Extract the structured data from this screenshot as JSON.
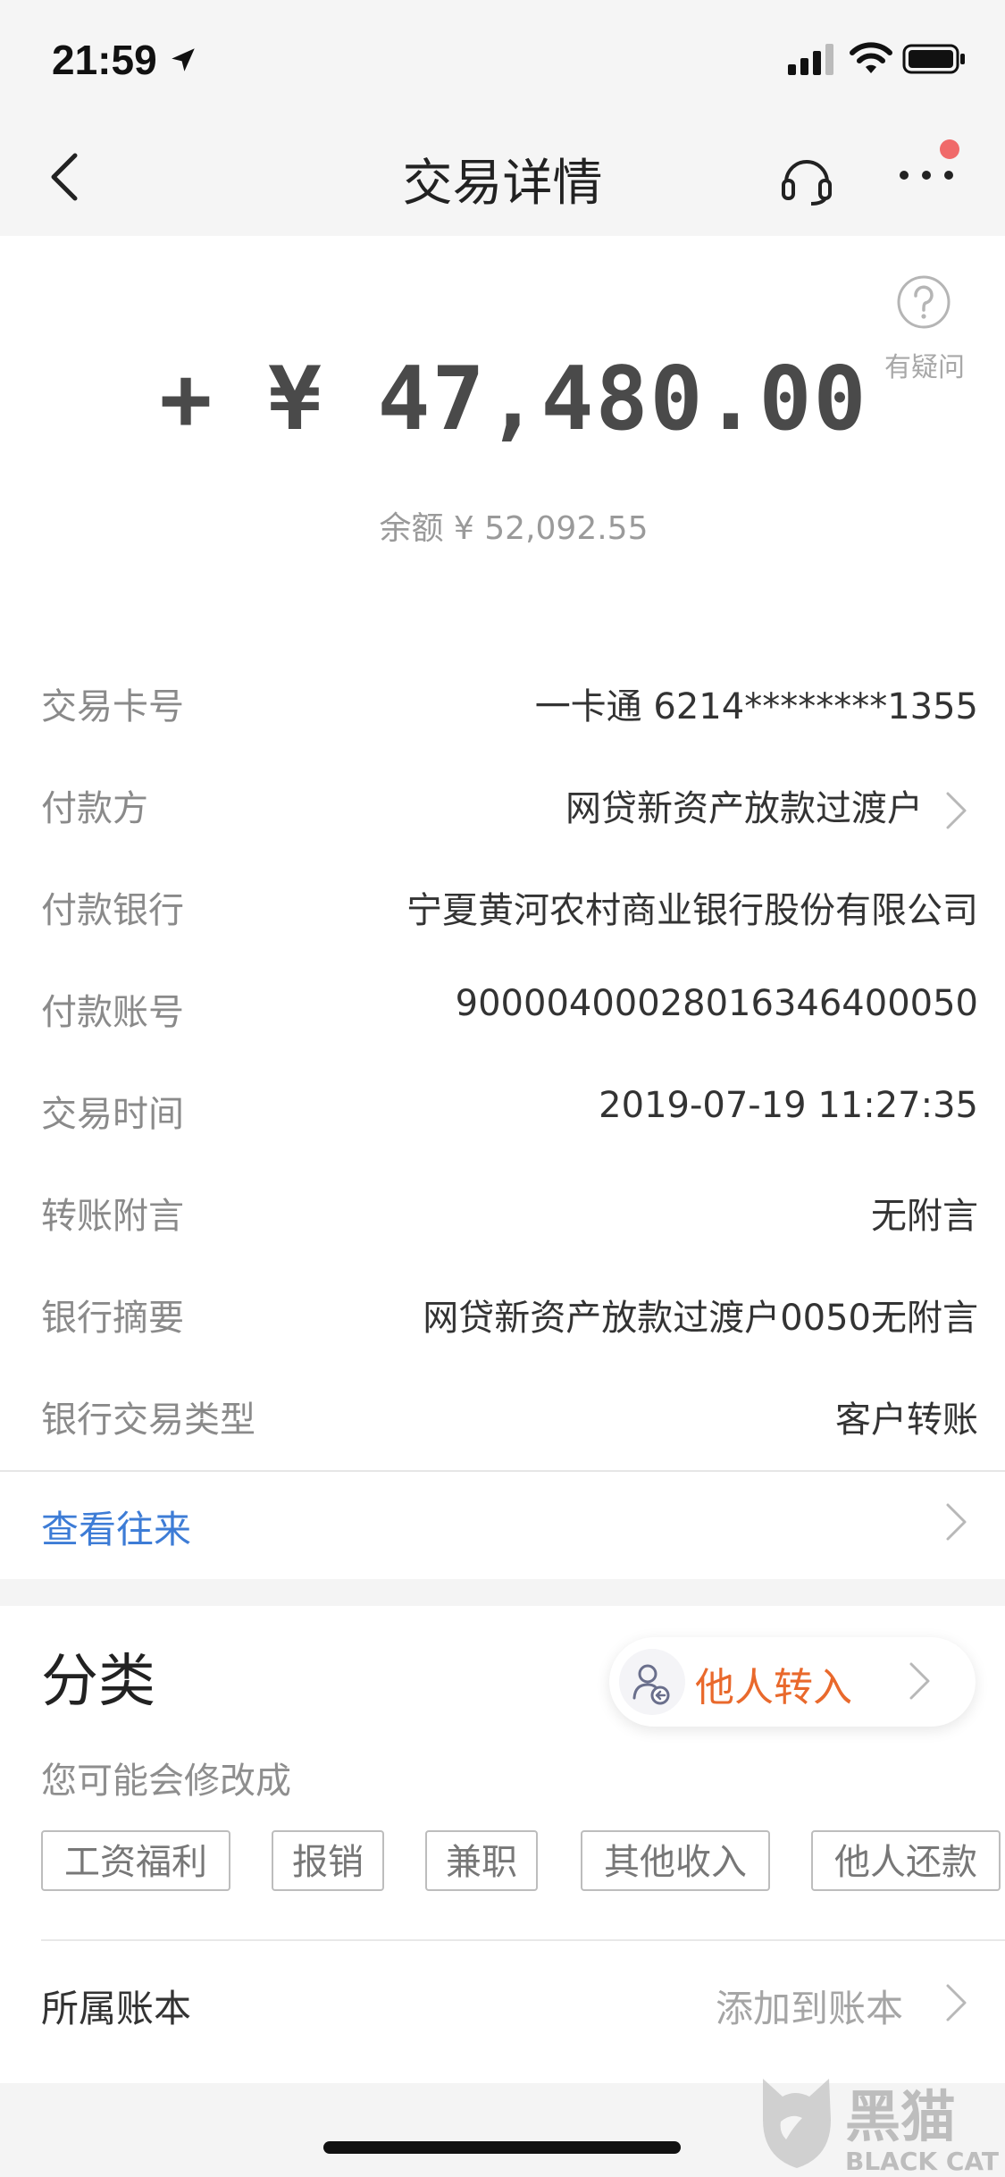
{
  "status_bar": {
    "time": "21:59"
  },
  "nav": {
    "title": "交易详情"
  },
  "help": {
    "label": "有疑问"
  },
  "transaction": {
    "amount": "+ ¥  47,480.00",
    "balance": "余额 ¥ 52,092.55"
  },
  "details": [
    {
      "label": "交易卡号",
      "value": "一卡通 6214********1355",
      "chevron": false
    },
    {
      "label": "付款方",
      "value": "网贷新资产放款过渡户",
      "chevron": true
    },
    {
      "label": "付款银行",
      "value": "宁夏黄河农村商业银行股份有限公司",
      "chevron": false
    },
    {
      "label": "付款账号",
      "value": "90000400028016346400050",
      "chevron": false
    },
    {
      "label": "交易时间",
      "value": "2019-07-19 11:27:35",
      "chevron": false
    },
    {
      "label": "转账附言",
      "value": "无附言",
      "chevron": false
    },
    {
      "label": "银行摘要",
      "value": "网贷新资产放款过渡户0050无附言",
      "chevron": false
    },
    {
      "label": "银行交易类型",
      "value": "客户转账",
      "chevron": false
    }
  ],
  "view_history": {
    "label": "查看往来"
  },
  "category": {
    "title": "分类",
    "current": "他人转入",
    "hint": "您可能会修改成",
    "tags": [
      "工资福利",
      "报销",
      "兼职",
      "其他收入",
      "他人还款"
    ]
  },
  "ledger": {
    "label": "所属账本",
    "action": "添加到账本"
  },
  "watermark": {
    "text_cn": "黑猫",
    "text_en": "BLACK CAT"
  },
  "colors": {
    "link_blue": "#3d7cd6",
    "category_orange": "#e9692c",
    "notification_red": "#f06a6a"
  }
}
